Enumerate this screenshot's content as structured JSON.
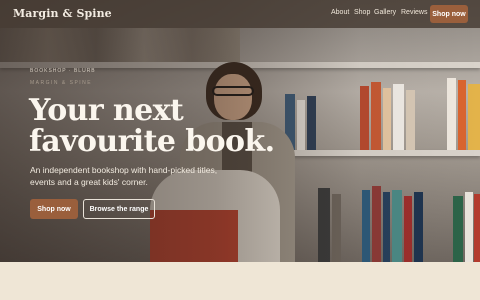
{
  "header": {
    "brand": "Margin & Spine",
    "nav": [
      "About",
      "Shop",
      "Gallery",
      "Reviews"
    ],
    "cta": "Shop now"
  },
  "hero": {
    "eyebrow": "BOOKSHOP · BLURB",
    "eyebrow_secondary": "MARGIN & SPINE",
    "headline_line1": "Your next",
    "headline_line2": "favourite book.",
    "subtitle_line1": "An independent bookshop with hand-picked titles,",
    "subtitle_line2": "events and a great kids' corner.",
    "primary_button": "Shop now",
    "secondary_button": "Browse the range"
  },
  "colors": {
    "accent": "#9a5f3c",
    "topbar": "#463a32",
    "page_bg": "#efe6d6",
    "headline": "#fbf6ee"
  }
}
